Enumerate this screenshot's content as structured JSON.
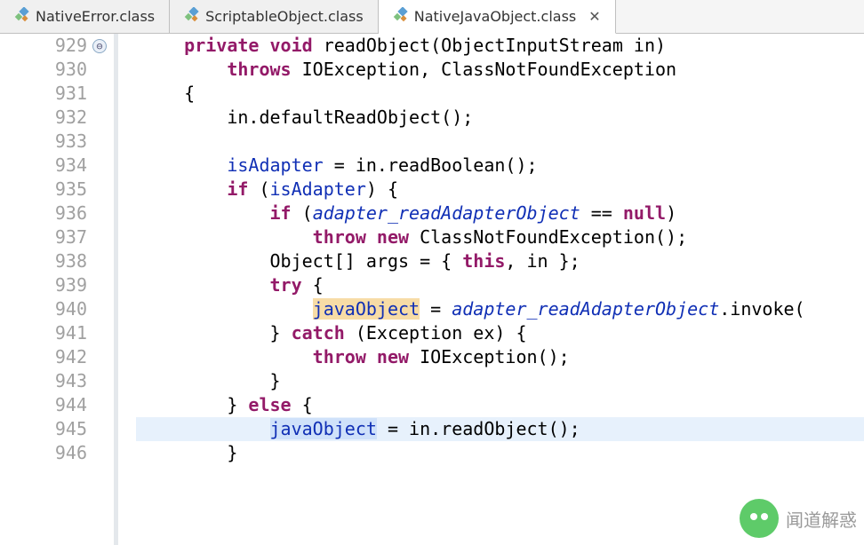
{
  "tabs": [
    {
      "label": "NativeError.class",
      "active": false
    },
    {
      "label": "ScriptableObject.class",
      "active": false
    },
    {
      "label": "NativeJavaObject.class",
      "active": true
    }
  ],
  "lines": {
    "start": 929,
    "end": 946,
    "foldable_line": 929,
    "current_line": 945
  },
  "code": {
    "l929": {
      "indent": "    ",
      "kw1": "private",
      "kw2": "void",
      "name": " readObject(ObjectInputStream in)"
    },
    "l930": {
      "indent": "        ",
      "kw": "throws",
      "rest": " IOException, ClassNotFoundException"
    },
    "l931": "    {",
    "l932": "        in.defaultReadObject();",
    "l933": "",
    "l934": {
      "indent": "        ",
      "fld": "isAdapter",
      "rest": " = in.readBoolean();"
    },
    "l935": {
      "indent": "        ",
      "kw": "if",
      "open": " (",
      "fld": "isAdapter",
      "close": ") {"
    },
    "l936": {
      "indent": "            ",
      "kw": "if",
      "open": " (",
      "fld": "adapter_readAdapterObject",
      "mid": " == ",
      "kw2": "null",
      "close": ")"
    },
    "l937": {
      "indent": "                ",
      "kw1": "throw",
      "kw2": "new",
      "rest": " ClassNotFoundException();"
    },
    "l938": {
      "indent": "            Object[] args = { ",
      "kw": "this",
      "rest": ", in };"
    },
    "l939": {
      "indent": "            ",
      "kw": "try",
      "rest": " {"
    },
    "l940": {
      "indent": "                ",
      "hy": "javaObject",
      "mid": " = ",
      "fld": "adapter_readAdapterObject",
      "rest": ".invoke("
    },
    "l941": {
      "indent": "            } ",
      "kw": "catch",
      "rest": " (Exception ex) {"
    },
    "l942": {
      "indent": "                ",
      "kw1": "throw",
      "kw2": "new",
      "rest": " IOException();"
    },
    "l943": "            }",
    "l944": {
      "indent": "        } ",
      "kw": "else",
      "rest": " {"
    },
    "l945": {
      "indent": "            ",
      "sel": "javaObject",
      "rest": " = in.readObject();"
    },
    "l946": "        }"
  },
  "watermark": "闻道解惑",
  "fold_glyph": "⊖"
}
